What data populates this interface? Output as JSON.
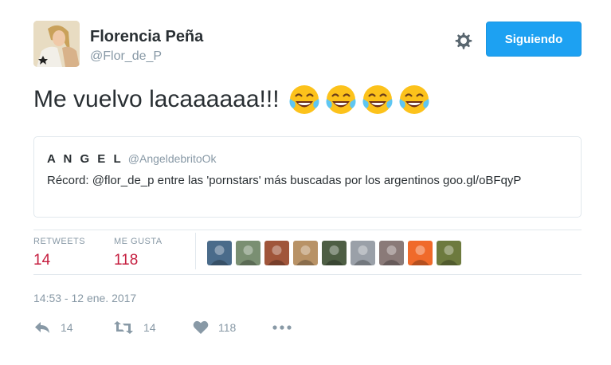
{
  "author": {
    "display_name": "Florencia Peña",
    "handle": "@Flor_de_P"
  },
  "follow_button_label": "Siguiendo",
  "tweet_text": "Me vuelvo lacaaaaaa!!!",
  "emoji": [
    "face-with-tears-of-joy",
    "face-with-tears-of-joy",
    "face-with-tears-of-joy",
    "face-with-tears-of-joy"
  ],
  "quoted": {
    "name": "A N G E L",
    "handle": "@AngeldebritoOk",
    "text": "Récord: @flor_de_p entre las 'pornstars' más buscadas por los argentinos goo.gl/oBFqyP"
  },
  "stats": {
    "retweets_label": "RETWEETS",
    "retweets_value": "14",
    "likes_label": "ME GUSTA",
    "likes_value": "118"
  },
  "likers": [
    {
      "icon": "user-avatar-1",
      "color": "#4a6b8a"
    },
    {
      "icon": "user-avatar-2",
      "color": "#7a8f72"
    },
    {
      "icon": "user-avatar-3",
      "color": "#a0553a"
    },
    {
      "icon": "user-avatar-4",
      "color": "#b89266"
    },
    {
      "icon": "user-avatar-5",
      "color": "#4e5e44"
    },
    {
      "icon": "user-avatar-6",
      "color": "#9aa0a8"
    },
    {
      "icon": "user-avatar-7",
      "color": "#8a7a78"
    },
    {
      "icon": "user-avatar-8",
      "color": "#f06a2a"
    },
    {
      "icon": "user-avatar-9",
      "color": "#6d7a3e"
    }
  ],
  "timestamp": "14:53 - 12 ene. 2017",
  "actions": {
    "reply_count": "14",
    "retweet_count": "14",
    "like_count": "118"
  },
  "colors": {
    "accent": "#1da1f2",
    "likes_red": "#c51d3e",
    "muted": "#8899a6"
  }
}
